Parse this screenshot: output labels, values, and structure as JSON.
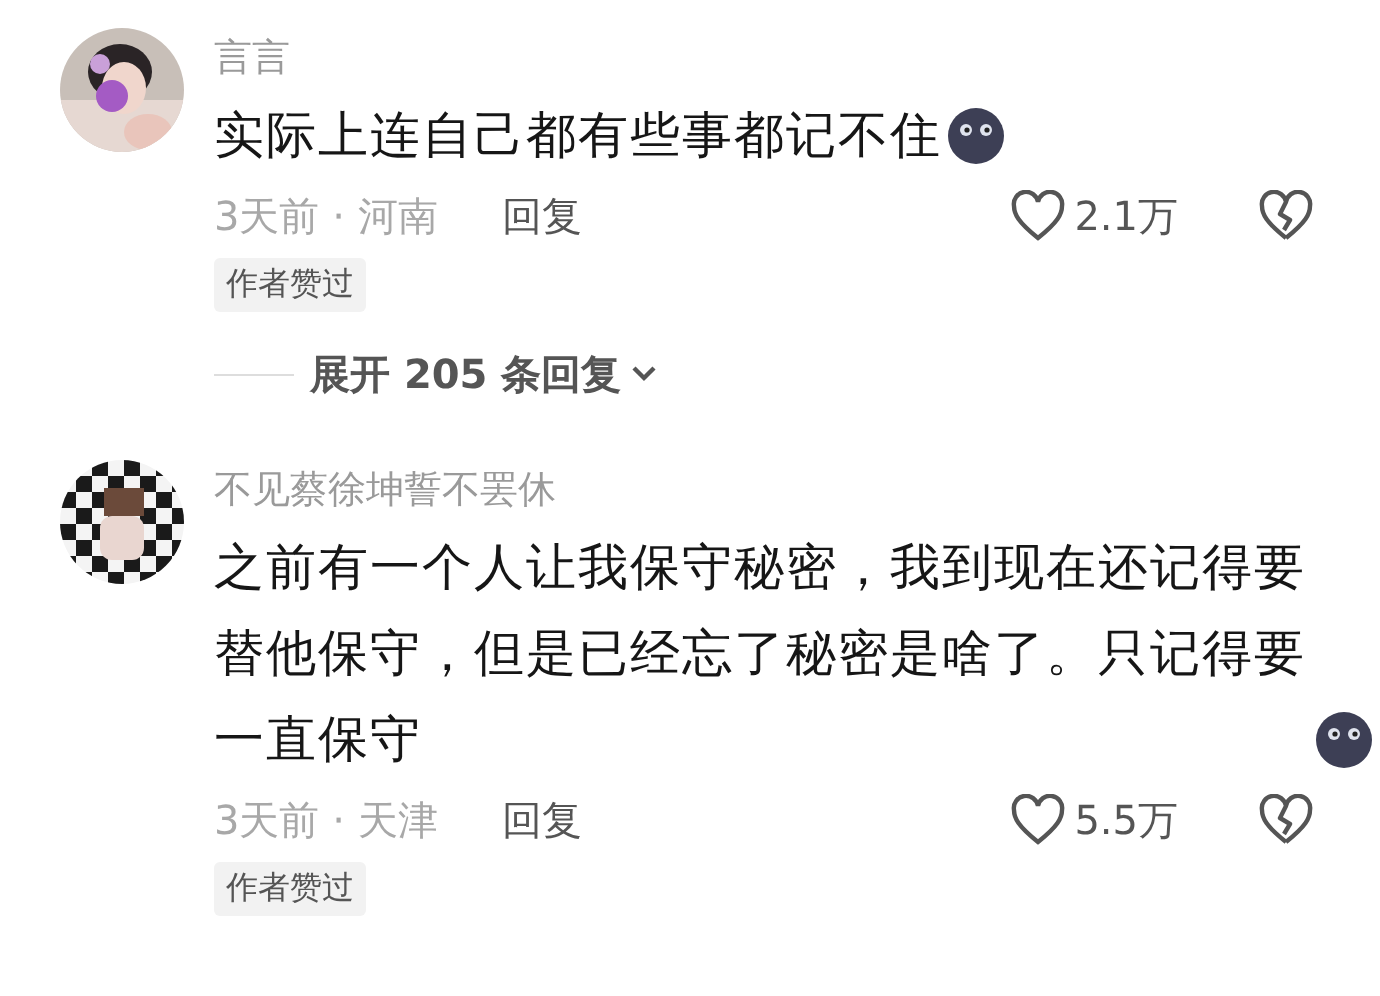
{
  "comments": [
    {
      "kind": "portrait",
      "author": "言言",
      "text": "实际上连自己都有些事都记不住",
      "time_location": "3天前 · 河南",
      "reply": "回复",
      "likes": "2.1万",
      "badge": "作者赞过",
      "more_replies": "展开 205 条回复"
    },
    {
      "kind": "checker",
      "author": "不见蔡徐坤誓不罢休",
      "text": "之前有一个人让我保守秘密，我到现在还记得要替他保守，但是已经忘了秘密是啥了。只记得要一直保守",
      "time_location": "3天前 · 天津",
      "reply": "回复",
      "likes": "5.5万",
      "badge": "作者赞过"
    }
  ]
}
